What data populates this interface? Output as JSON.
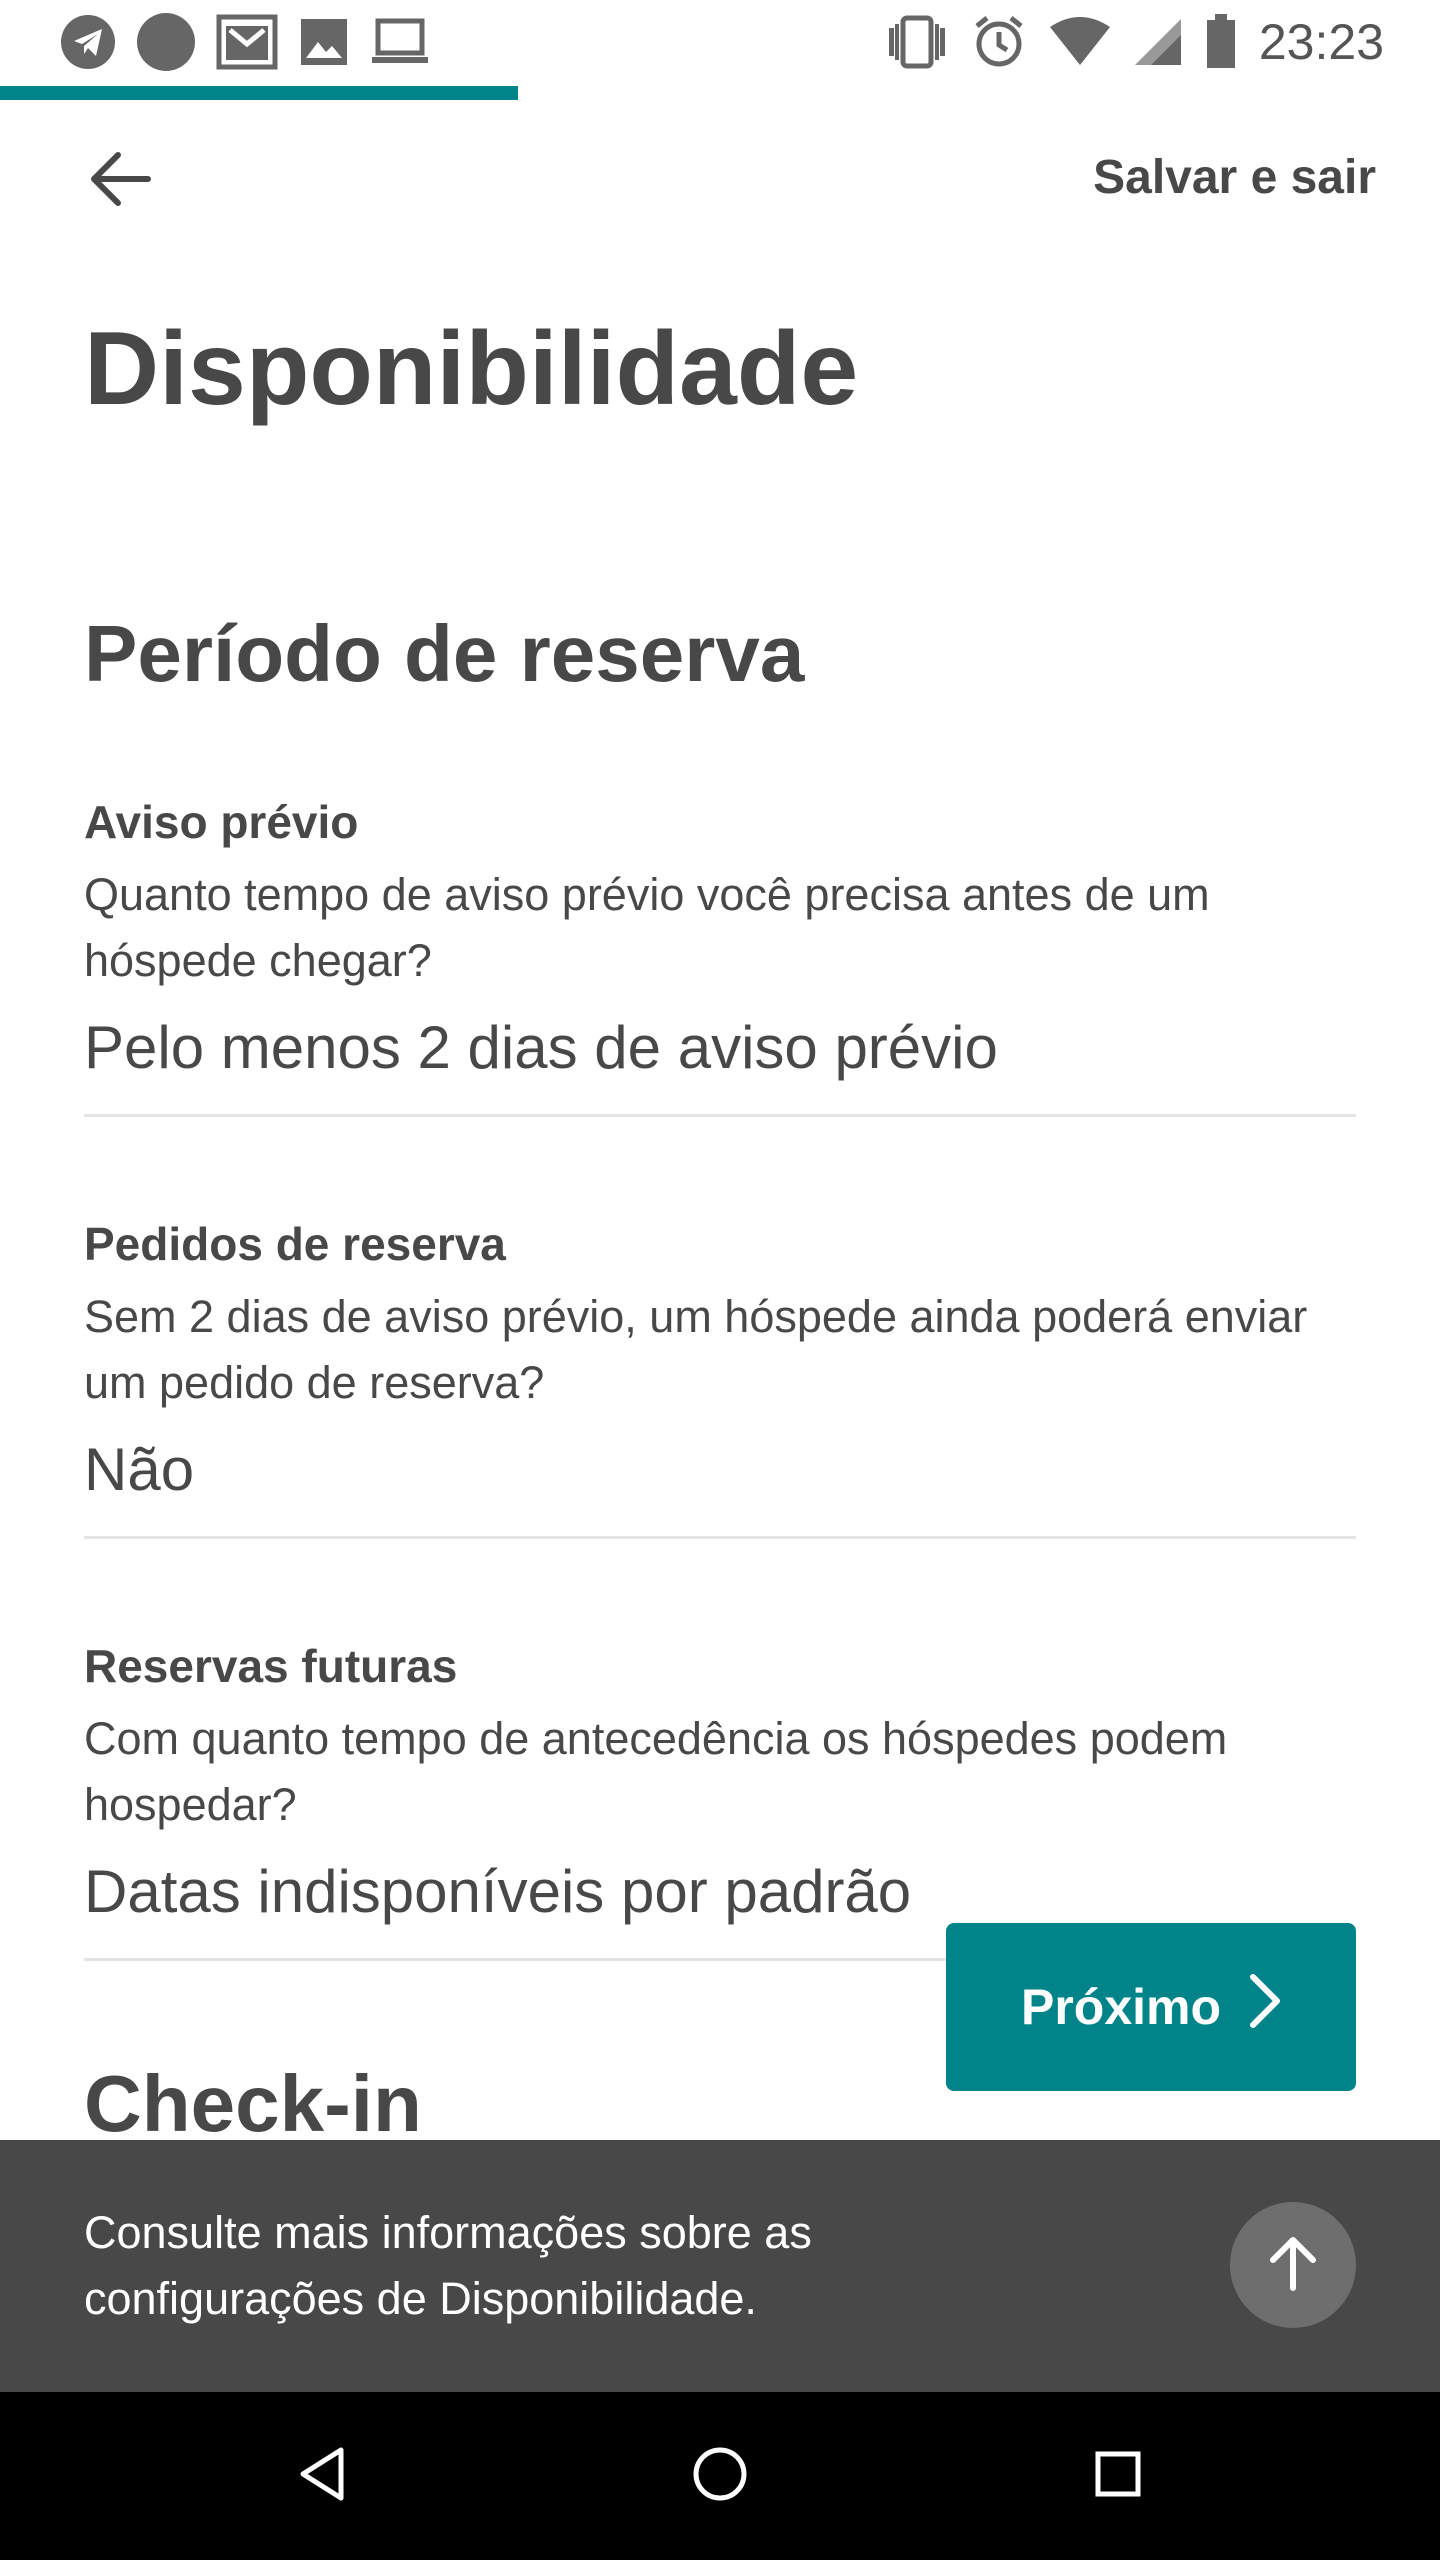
{
  "status_bar": {
    "time": "23:23",
    "left_icons": [
      "telegram-icon",
      "circle-icon",
      "gmail-icon",
      "image-icon",
      "laptop-icon"
    ],
    "right_icons": [
      "vibrate-icon",
      "alarm-icon",
      "wifi-icon",
      "signal-icon",
      "battery-icon"
    ]
  },
  "progress": {
    "fraction": 0.36,
    "color": "#008489"
  },
  "header": {
    "back_icon": "arrow-left-icon",
    "save_exit_label": "Salvar e sair"
  },
  "page": {
    "title": "Disponibilidade",
    "section_title": "Período de reserva",
    "fields": [
      {
        "label": "Aviso prévio",
        "description": "Quanto tempo de aviso prévio você precisa antes de um hóspede chegar?",
        "value": "Pelo menos 2 dias de aviso prévio"
      },
      {
        "label": "Pedidos de reserva",
        "description": "Sem 2 dias de aviso prévio, um hóspede ainda poderá enviar um pedido de reserva?",
        "value": "Não"
      },
      {
        "label": "Reservas futuras",
        "description": "Com quanto tempo de antecedência os hóspedes podem hospedar?",
        "value": "Datas indisponíveis por padrão"
      }
    ],
    "next_section_title": "Check-in"
  },
  "next_button": {
    "label": "Próximo",
    "icon": "chevron-right-icon"
  },
  "snackbar": {
    "text": "Consulte mais informações sobre as configurações de Disponibilidade.",
    "icon": "arrow-up-icon"
  },
  "nav_bar": {
    "icons": [
      "back-triangle-icon",
      "home-circle-icon",
      "recents-square-icon"
    ]
  },
  "colors": {
    "accent": "#008489",
    "text": "#484848",
    "snackbar": "#484848"
  }
}
